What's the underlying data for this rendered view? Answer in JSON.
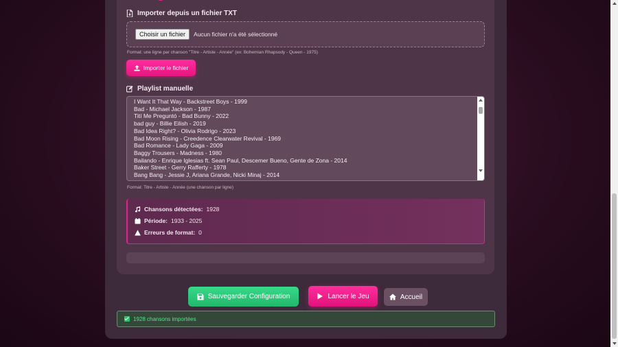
{
  "import_section": {
    "title": "Importer depuis un fichier TXT",
    "file_button": "Choisir un fichier",
    "file_status": "Aucun fichier n'a été sélectionné",
    "format_hint": "Format: une ligne par chanson \"Titre - Artiste - Année\" (ex: Bohemian Rhapsody - Queen - 1975)",
    "import_button": "Importer le fichier"
  },
  "manual_section": {
    "title": "Playlist manuelle",
    "lines": [
      "I Want It That Way - Backstreet Boys - 1999",
      "Bad - Michael Jackson - 1987",
      "Tití Me Preguntó - Bad Bunny - 2022",
      "bad guy - Billie Eilish - 2019",
      "Bad Idea Right? - Olivia Rodrigo - 2023",
      "Bad Moon Rising - Creedence Clearwater Revival - 1969",
      "Bad Romance - Lady Gaga - 2009",
      "Baggy Trousers - Madness - 1980",
      "Bailando - Enrique Iglesias ft. Sean Paul, Descemer Bueno, Gente de Zona - 2014",
      "Baker Street - Gerry Rafferty - 1978",
      "Bang Bang - Jessie J, Ariana Grande, Nicki Minaj - 2014"
    ],
    "format_hint": "Format: Titre - Artiste - Année (une chanson par ligne)"
  },
  "stats": {
    "songs_label": "Chansons détectées:",
    "songs_value": "1928",
    "period_label": "Période:",
    "period_value": "1933 - 2025",
    "errors_label": "Erreurs de format:",
    "errors_value": "0"
  },
  "actions": {
    "save": "Sauvegarder Configuration",
    "launch": "Lancer le Jeu",
    "home": "Accueil"
  },
  "notification": {
    "text": "1928 chansons importées"
  },
  "colors": {
    "accent": "#e0238e",
    "success": "#22b86b",
    "panel": "#3d2a3a"
  }
}
